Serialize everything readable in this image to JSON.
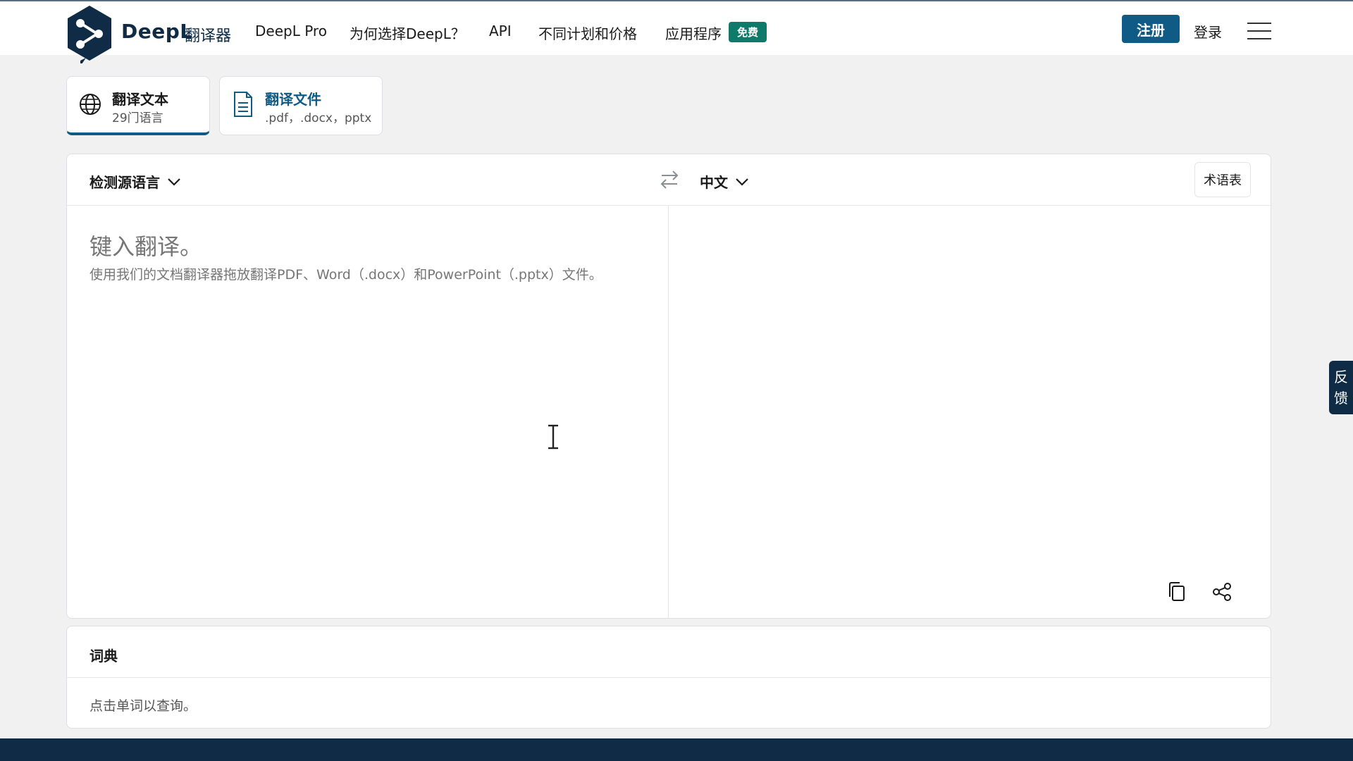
{
  "header": {
    "brand": "DeepL",
    "brand_sub": "翻译器",
    "nav": {
      "pro": "DeepL Pro",
      "why": "为何选择DeepL？",
      "api": "API",
      "plans": "不同计划和价格",
      "apps": "应用程序",
      "apps_badge": "免费"
    },
    "signup": "注册",
    "login": "登录"
  },
  "tabs": {
    "text": {
      "title": "翻译文本",
      "sub": "29门语言"
    },
    "file": {
      "title": "翻译文件",
      "sub": ".pdf，.docx，pptx"
    }
  },
  "translator": {
    "source_lang": "检测源语言",
    "target_lang": "中文",
    "glossary": "术语表",
    "placeholder": "键入翻译。",
    "hint": "使用我们的文档翻译器拖放翻译PDF、Word（.docx）和PowerPoint（.pptx）文件。"
  },
  "dictionary": {
    "title": "词典",
    "hint": "点击单词以查询。"
  },
  "feedback": {
    "line1": "反",
    "line2": "馈"
  },
  "colors": {
    "brand_navy": "#0f2b46",
    "accent_blue": "#0f5b85",
    "badge_green": "#0f7a6a"
  }
}
